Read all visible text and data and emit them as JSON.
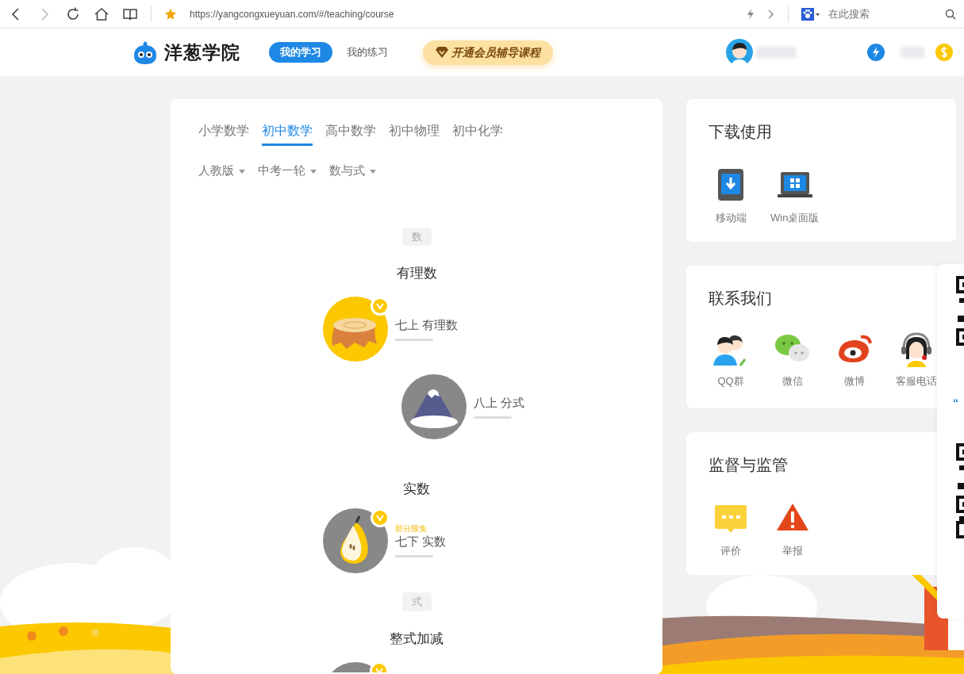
{
  "browser": {
    "url": "https://yangcongxueyuan.com/#/teaching/course",
    "search_placeholder": "在此搜索",
    "forward_disabled": true
  },
  "header": {
    "logo": "洋葱学院",
    "nav": [
      {
        "label": "我的学习",
        "selected": true
      },
      {
        "label": "我的练习",
        "selected": false
      }
    ],
    "vip_button": "开通会员辅导课程"
  },
  "subject_tabs": [
    {
      "label": "小学数学",
      "selected": false
    },
    {
      "label": "初中数学",
      "selected": true
    },
    {
      "label": "高中数学",
      "selected": false
    },
    {
      "label": "初中物理",
      "selected": false
    },
    {
      "label": "初中化学",
      "selected": false
    }
  ],
  "filters": [
    "人教版",
    "中考一轮",
    "数与式"
  ],
  "sections": [
    {
      "label": "数",
      "units": [
        {
          "title": "有理数",
          "lessons": [
            {
              "title": "七上 有理数",
              "kind": "stump",
              "highlighted": true,
              "completed": true
            },
            {
              "title": "八上 分式",
              "kind": "mountain",
              "highlighted": false,
              "completed": false
            }
          ]
        },
        {
          "title": "实数",
          "lessons": [
            {
              "tag": "部分限免",
              "title": "七下 实数",
              "kind": "pear",
              "highlighted": false,
              "completed": true
            }
          ]
        }
      ]
    },
    {
      "label": "式",
      "units": [
        {
          "title": "整式加减",
          "lessons": [
            {
              "highlighted": false,
              "completed": true
            }
          ]
        }
      ]
    }
  ],
  "side_cards": [
    {
      "title": "下载使用",
      "items": [
        {
          "label": "移动端",
          "kind": "phone"
        },
        {
          "label": "Win桌面版",
          "kind": "laptop"
        }
      ]
    },
    {
      "title": "联系我们",
      "items": [
        {
          "label": "QQ群",
          "kind": "people"
        },
        {
          "label": "微信",
          "kind": "chat"
        },
        {
          "label": "微博",
          "kind": "eye"
        },
        {
          "label": "客服电话",
          "kind": "agent"
        }
      ]
    },
    {
      "title": "监督与监管",
      "items": [
        {
          "label": "评价",
          "kind": "comment"
        },
        {
          "label": "举报",
          "kind": "warning"
        }
      ]
    }
  ],
  "qr_panel": {
    "caption": "“"
  }
}
